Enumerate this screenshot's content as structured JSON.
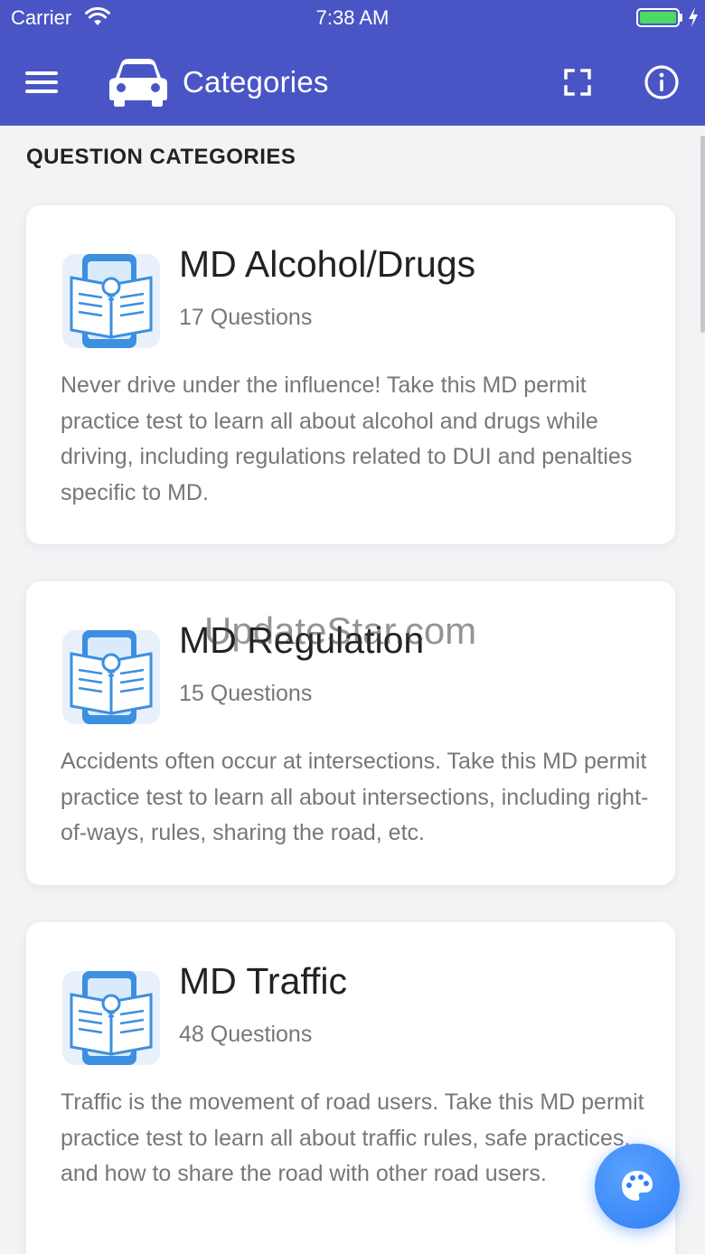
{
  "status_bar": {
    "carrier": "Carrier",
    "time": "7:38 AM"
  },
  "nav": {
    "title": "Categories",
    "icons": {
      "menu": "hamburger-menu-icon",
      "logo": "car-icon",
      "expand": "fullscreen-icon",
      "info": "info-icon"
    }
  },
  "section": {
    "title": "QUESTION CATEGORIES"
  },
  "categories": [
    {
      "title": "MD Alcohol/Drugs",
      "count": "17 Questions",
      "description": "Never drive under the influence! Take this MD permit practice test to learn all about alcohol and drugs while driving, including regulations related to DUI and penalties specific to MD."
    },
    {
      "title": "MD Regulation",
      "count": "15 Questions",
      "description": "Accidents often occur at intersections. Take this MD permit practice test to learn all about intersections, including right-of-ways, rules, sharing the road, etc."
    },
    {
      "title": "MD Traffic",
      "count": "48 Questions",
      "description": "Traffic is the movement of road users. Take this MD permit practice test to learn all about traffic rules, safe practices, and how to share the road with other road users."
    }
  ],
  "watermark": "UpdateStar.com",
  "fab": {
    "icon": "palette-icon"
  },
  "colors": {
    "nav_bg": "#4a55c5",
    "fab": "#2f7df6",
    "battery": "#4cd964"
  }
}
